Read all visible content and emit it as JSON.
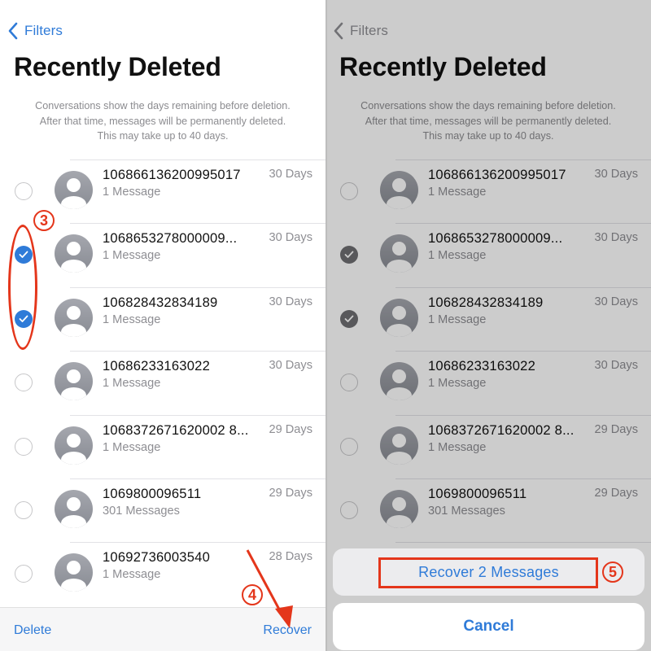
{
  "nav": {
    "back_label": "Filters"
  },
  "header": {
    "title": "Recently Deleted"
  },
  "info_text": [
    "Conversations show the days remaining before deletion.",
    "After that time, messages will be permanently deleted.",
    "This may take up to 40 days."
  ],
  "conversations": [
    {
      "name": "106866136200995017",
      "count": "1 Message",
      "days": "30 Days",
      "selected": false
    },
    {
      "name": "1068653278000009...",
      "count": "1 Message",
      "days": "30 Days",
      "selected": true
    },
    {
      "name": "106828432834189",
      "count": "1 Message",
      "days": "30 Days",
      "selected": true
    },
    {
      "name": "10686233163022",
      "count": "1 Message",
      "days": "30 Days",
      "selected": false
    },
    {
      "name": "1068372671620002 8...",
      "count": "1 Message",
      "days": "29 Days",
      "selected": false
    },
    {
      "name": "1069800096511",
      "count": "301 Messages",
      "days": "29 Days",
      "selected": false
    },
    {
      "name": "10692736003540",
      "count": "1 Message",
      "days": "28 Days",
      "selected": false
    }
  ],
  "toolbar": {
    "delete_label": "Delete",
    "recover_label": "Recover"
  },
  "action_sheet": {
    "recover_label": "Recover 2 Messages",
    "cancel_label": "Cancel"
  },
  "annotations": {
    "step3": "3",
    "step4": "4",
    "step5": "5"
  },
  "colors": {
    "accent": "#2f7bd8",
    "annotation": "#e4361b",
    "secondary_text": "#8e8e93"
  }
}
